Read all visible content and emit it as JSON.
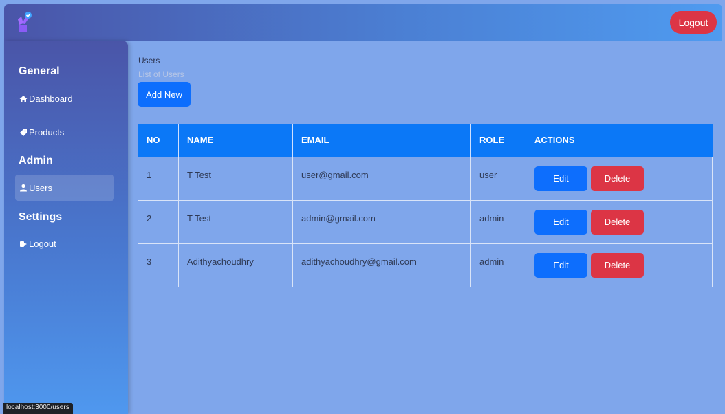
{
  "topbar": {
    "logout_label": "Logout",
    "logo_icon": "rocket-hand-icon"
  },
  "sidebar": {
    "sections": [
      {
        "heading": "General",
        "items": [
          {
            "label": "Dashboard",
            "icon": "home-icon"
          },
          {
            "label": "Products",
            "icon": "tag-icon"
          }
        ]
      },
      {
        "heading": "Admin",
        "items": [
          {
            "label": "Users",
            "icon": "user-icon",
            "active": true
          }
        ]
      },
      {
        "heading": "Settings",
        "items": [
          {
            "label": "Logout",
            "icon": "signout-icon"
          }
        ]
      }
    ]
  },
  "main": {
    "title": "Users",
    "subtitle": "List of Users",
    "add_button": "Add New",
    "table": {
      "columns": [
        "NO",
        "NAME",
        "EMAIL",
        "ROLE",
        "ACTIONS"
      ],
      "rows": [
        {
          "no": "1",
          "name": "T Test",
          "email": "user@gmail.com",
          "role": "user"
        },
        {
          "no": "2",
          "name": "T Test",
          "email": "admin@gmail.com",
          "role": "admin"
        },
        {
          "no": "3",
          "name": "Adithyachoudhry",
          "email": "adithyachoudhry@gmail.com",
          "role": "admin"
        }
      ],
      "edit_label": "Edit",
      "delete_label": "Delete"
    }
  },
  "status_bar": {
    "url": "localhost:3000/users"
  },
  "colors": {
    "primary": "#0d6efd",
    "danger": "#dc3545",
    "table_header": "#0b78f7",
    "page_background": "#7fa6eb"
  }
}
